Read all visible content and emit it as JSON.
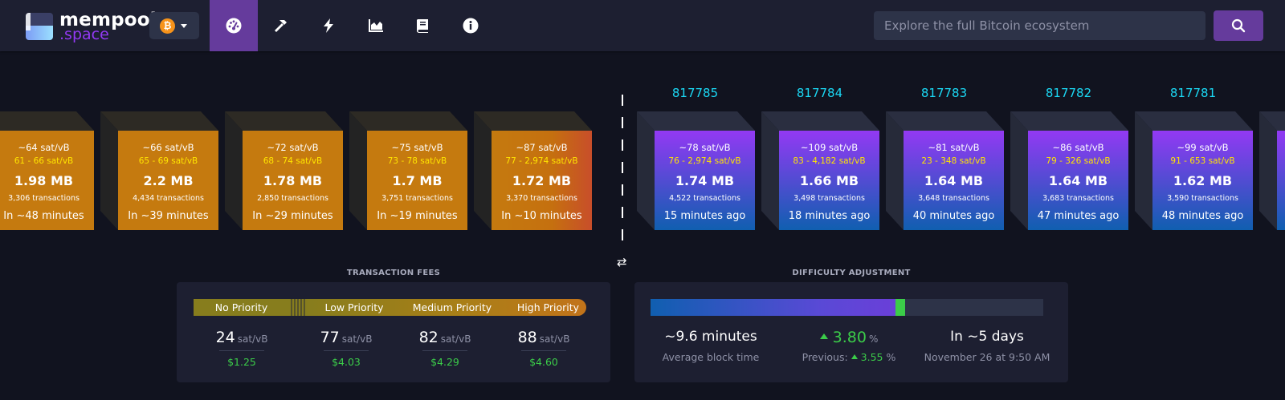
{
  "logo": {
    "line1": "mempool",
    "line2": ".space"
  },
  "network": {
    "icon": "bitcoin-icon",
    "symbol": "₿"
  },
  "nav": [
    {
      "name": "dashboard",
      "icon": "gauge-icon",
      "active": true
    },
    {
      "name": "mining",
      "icon": "hammer-icon"
    },
    {
      "name": "lightning",
      "icon": "lightning-icon"
    },
    {
      "name": "graphs",
      "icon": "area-chart-icon"
    },
    {
      "name": "docs",
      "icon": "book-icon"
    },
    {
      "name": "about",
      "icon": "info-icon"
    }
  ],
  "search": {
    "placeholder": "Explore the full Bitcoin ecosystem",
    "value": ""
  },
  "mempool_blocks": [
    {
      "median": "~64 sat/vB",
      "range": "61 - 66 sat/vB",
      "size": "1.98 MB",
      "tx": "3,306 transactions",
      "time": "In ~48 minutes"
    },
    {
      "median": "~66 sat/vB",
      "range": "65 - 69 sat/vB",
      "size": "2.2 MB",
      "tx": "4,434 transactions",
      "time": "In ~39 minutes"
    },
    {
      "median": "~72 sat/vB",
      "range": "68 - 74 sat/vB",
      "size": "1.78 MB",
      "tx": "2,850 transactions",
      "time": "In ~29 minutes"
    },
    {
      "median": "~75 sat/vB",
      "range": "73 - 78 sat/vB",
      "size": "1.7 MB",
      "tx": "3,751 transactions",
      "time": "In ~19 minutes"
    },
    {
      "median": "~87 sat/vB",
      "range": "77 - 2,974 sat/vB",
      "size": "1.72 MB",
      "tx": "3,370 transactions",
      "time": "In ~10 minutes"
    }
  ],
  "mined_blocks": [
    {
      "height": "817785",
      "median": "~78 sat/vB",
      "range": "76 - 2,974 sat/vB",
      "size": "1.74 MB",
      "tx": "4,522 transactions",
      "time": "15 minutes ago"
    },
    {
      "height": "817784",
      "median": "~109 sat/vB",
      "range": "83 - 4,182 sat/vB",
      "size": "1.66 MB",
      "tx": "3,498 transactions",
      "time": "18 minutes ago"
    },
    {
      "height": "817783",
      "median": "~81 sat/vB",
      "range": "23 - 348 sat/vB",
      "size": "1.64 MB",
      "tx": "3,648 transactions",
      "time": "40 minutes ago"
    },
    {
      "height": "817782",
      "median": "~86 sat/vB",
      "range": "79 - 326 sat/vB",
      "size": "1.64 MB",
      "tx": "3,683 transactions",
      "time": "47 minutes ago"
    },
    {
      "height": "817781",
      "median": "~99 sat/vB",
      "range": "91 - 653 sat/vB",
      "size": "1.62 MB",
      "tx": "3,590 transactions",
      "time": "48 minutes ago"
    }
  ],
  "fees": {
    "title": "TRANSACTION FEES",
    "labels": [
      "No Priority",
      "Low Priority",
      "Medium Priority",
      "High Priority"
    ],
    "unit": "sat/vB",
    "values": [
      {
        "rate": "24",
        "usd": "$1.25"
      },
      {
        "rate": "77",
        "usd": "$4.03"
      },
      {
        "rate": "82",
        "usd": "$4.29"
      },
      {
        "rate": "88",
        "usd": "$4.60"
      }
    ]
  },
  "difficulty": {
    "title": "DIFFICULTY ADJUSTMENT",
    "progress_fraction": 0.624,
    "block_time": "~9.6 minutes",
    "block_time_label": "Average block time",
    "change": "3.80",
    "change_unit": "%",
    "previous_label": "Previous:",
    "previous_value": "3.55",
    "previous_unit": "%",
    "eta": "In ~5 days",
    "eta_date": "November 26 at 9:50 AM"
  },
  "colors": {
    "accent": "#653b9c",
    "pending_block": "#c57a0f",
    "mined_top": "#9339f4",
    "mined_bottom": "#105fb0",
    "height_link": "#1bd8f4",
    "green": "#3bcc49",
    "fee_range": "#ffe500"
  }
}
